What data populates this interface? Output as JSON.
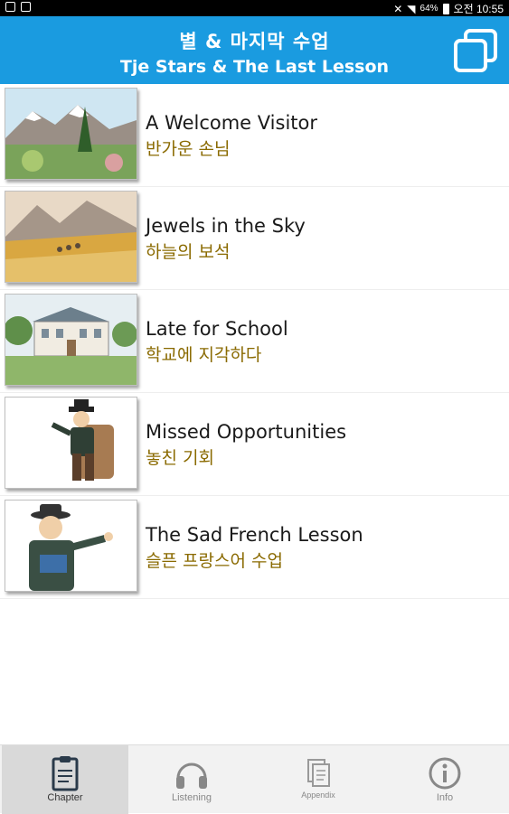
{
  "statusbar": {
    "battery": "64%",
    "time": "오전 10:55"
  },
  "header": {
    "title_ko": "별 & 마지막 수업",
    "title_en": "Tje Stars & The Last Lesson",
    "copy_icon": "copy-icon"
  },
  "chapters": [
    {
      "en": "A Welcome Visitor",
      "ko": "반가운 손님"
    },
    {
      "en": "Jewels in the Sky",
      "ko": "하늘의 보석"
    },
    {
      "en": "Late for School",
      "ko": "학교에 지각하다"
    },
    {
      "en": "Missed Opportunities",
      "ko": "놓친 기회"
    },
    {
      "en": "The Sad French Lesson",
      "ko": "슬픈 프랑스어 수업"
    }
  ],
  "tabs": [
    {
      "label": "Chapter",
      "icon": "clipboard-icon"
    },
    {
      "label": "Listening",
      "icon": "headphones-icon"
    },
    {
      "label": "Appendix",
      "icon": "pages-icon"
    },
    {
      "label": "Info",
      "icon": "info-icon"
    }
  ],
  "colors": {
    "header": "#1a9be0",
    "korean_text": "#8a6a00"
  }
}
